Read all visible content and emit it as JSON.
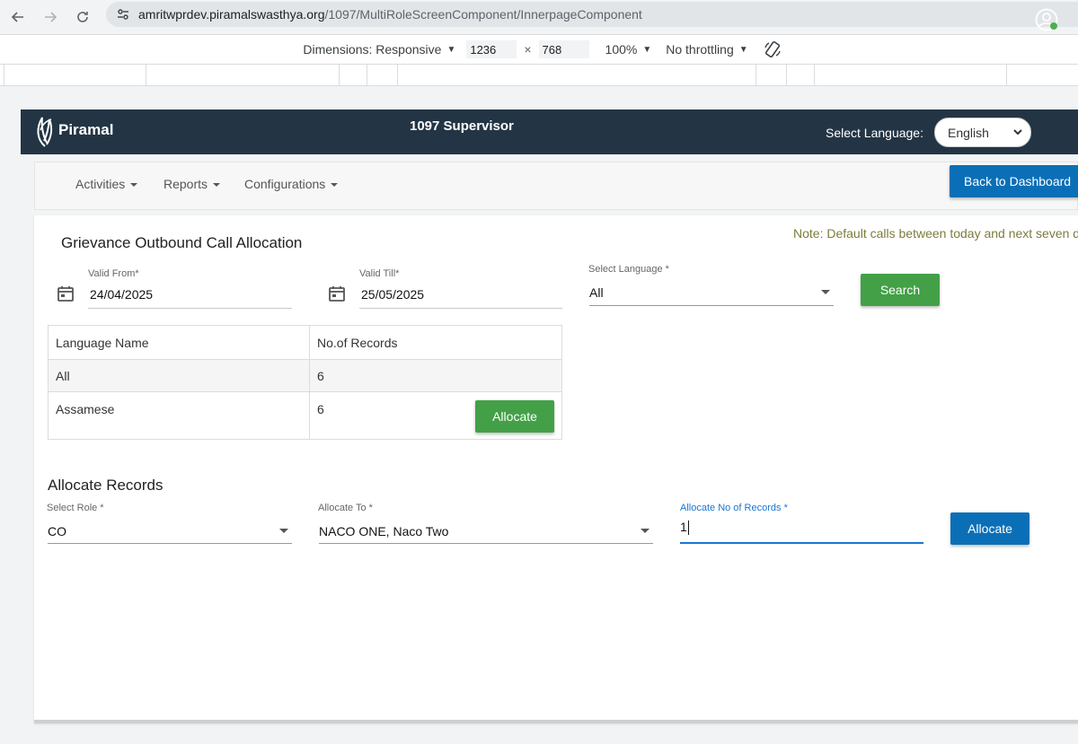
{
  "browser": {
    "url_host": "amritwprdev.piramalswasthya.org",
    "url_path": "/1097/MultiRoleScreenComponent/InnerpageComponent"
  },
  "devtools": {
    "dimensions_label": "Dimensions: Responsive",
    "width": "1236",
    "times": "×",
    "height": "768",
    "zoom": "100%",
    "throttling": "No throttling"
  },
  "header": {
    "logo_text": "Piramal",
    "title": "1097 Supervisor",
    "language_label": "Select Language:",
    "language_value": "English"
  },
  "nav": {
    "items": [
      {
        "label": "Activities"
      },
      {
        "label": "Reports"
      },
      {
        "label": "Configurations"
      }
    ],
    "back_button": "Back to Dashboard"
  },
  "grievance": {
    "title": "Grievance Outbound Call Allocation",
    "note": "Note: Default calls between today and next seven da",
    "valid_from_label": "Valid From*",
    "valid_from_value": "24/04/2025",
    "valid_till_label": "Valid Till*",
    "valid_till_value": "25/05/2025",
    "select_language_label": "Select Language *",
    "select_language_value": "All",
    "search_button": "Search"
  },
  "table": {
    "headers": [
      "Language Name",
      "No.of Records"
    ],
    "rows": [
      {
        "language": "All",
        "records": "6"
      },
      {
        "language": "Assamese",
        "records": "6"
      }
    ],
    "row_allocate_button": "Allocate"
  },
  "allocate": {
    "title": "Allocate Records",
    "role_label": "Select Role *",
    "role_value": "CO",
    "to_label": "Allocate To *",
    "to_value": "NACO ONE, Naco Two",
    "count_label": "Allocate No of Records",
    "count_required_mark": "*",
    "count_value": "1",
    "button": "Allocate"
  },
  "colors": {
    "header_bg": "#233545",
    "primary_blue": "#0b6fb7",
    "success_green": "#43a047",
    "focus_blue": "#1976d2"
  }
}
